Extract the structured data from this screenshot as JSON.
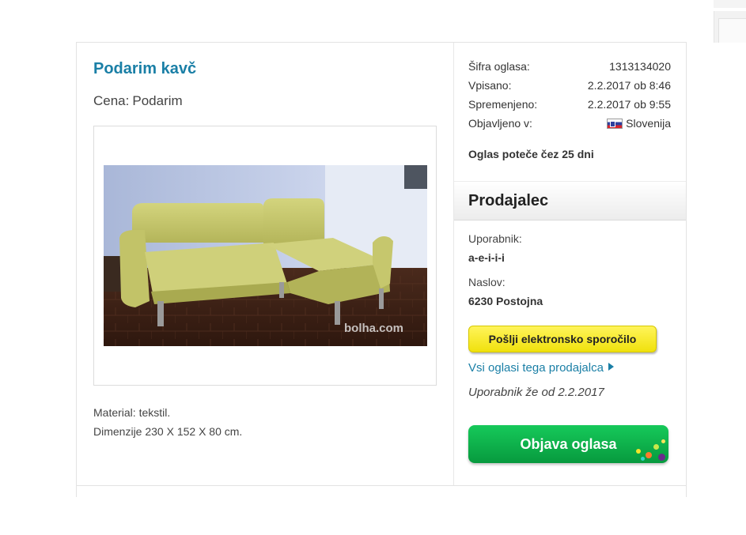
{
  "ad": {
    "title": "Podarim kavč",
    "price_label": "Cena:",
    "price_value": "Podarim",
    "photo_watermark": "bolha.com",
    "description": [
      "Material: tekstil.",
      "Dimenzije 230 X 152 X 80 cm."
    ]
  },
  "meta": [
    {
      "key": "Šifra oglasa:",
      "value": "1313134020"
    },
    {
      "key": "Vpisano:",
      "value": "2.2.2017 ob 8:46"
    },
    {
      "key": "Spremenjeno:",
      "value": "2.2.2017 ob 9:55"
    },
    {
      "key": "Objavljeno v:",
      "value": "Slovenija",
      "icon": "slovenia-flag-icon"
    }
  ],
  "expires": "Oglas poteče čez 25 dni",
  "seller": {
    "heading": "Prodajalec",
    "user_label": "Uporabnik:",
    "user_value": "a-e-i-i-i",
    "address_label": "Naslov:",
    "address_value": "6230 Postojna",
    "message_button": "Pošlji elektronsko sporočilo",
    "all_ads_link": "Vsi oglasi tega prodajalca",
    "member_since": "Uporabnik že od 2.2.2017"
  },
  "publish_button": "Objava oglasa",
  "colors": {
    "link": "#1a7fa6",
    "message_button": "#f5e820",
    "publish_button": "#0fb24c"
  }
}
